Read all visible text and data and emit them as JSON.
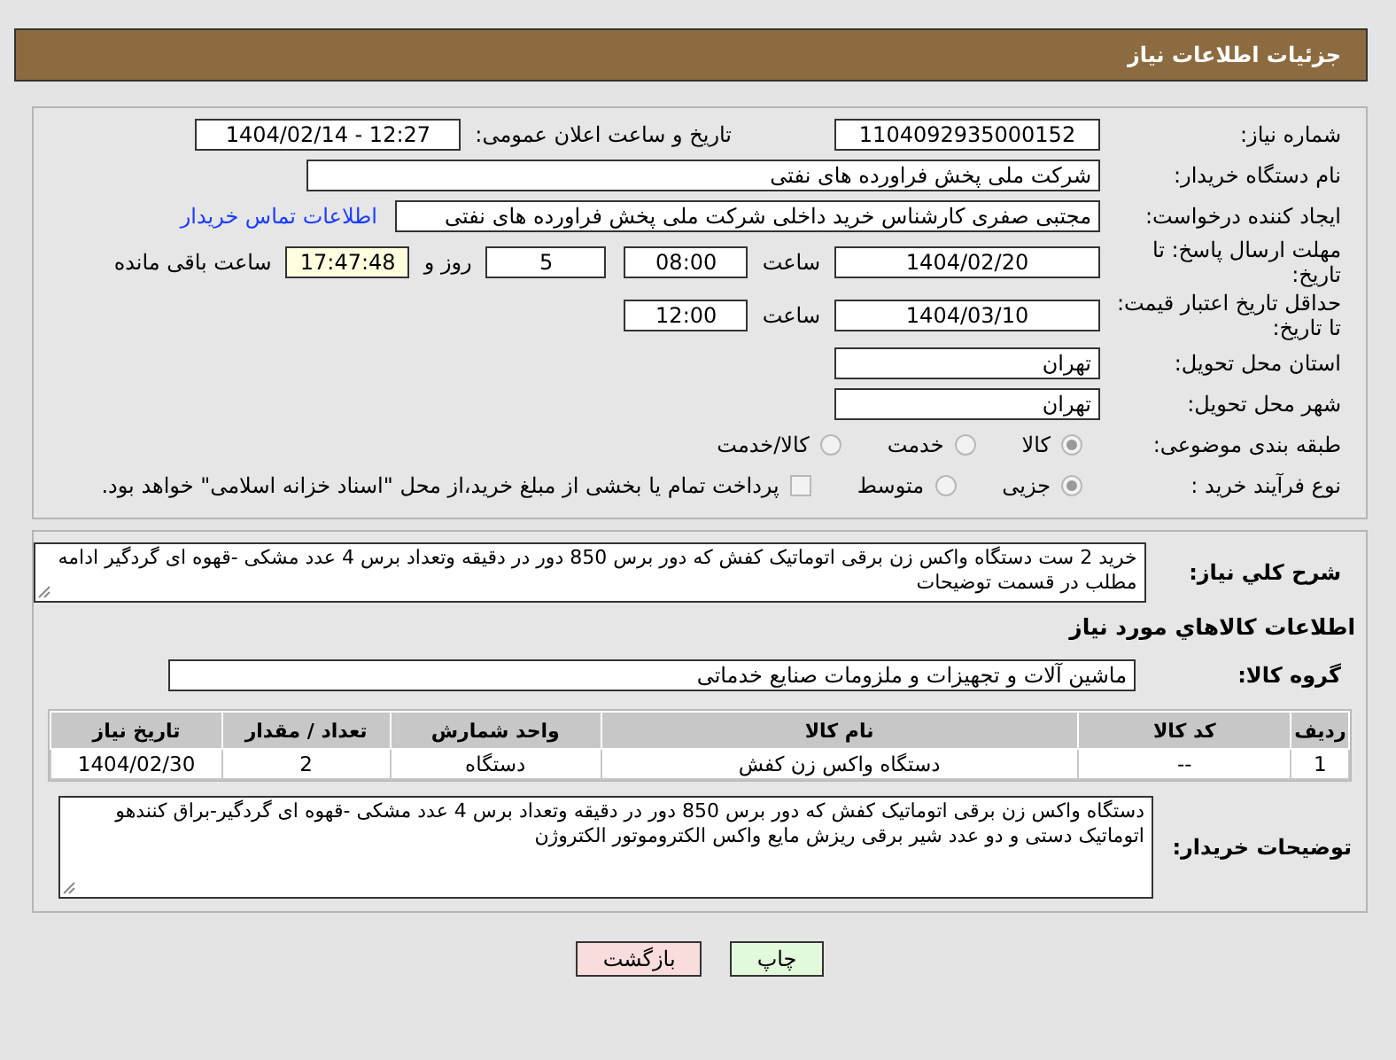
{
  "header": {
    "title": "جزئیات اطلاعات نیاز"
  },
  "need_number": {
    "label": "شماره نیاز:",
    "value": "1104092935000152"
  },
  "announce": {
    "label": "تاریخ و ساعت اعلان عمومی:",
    "value": "1404/02/14 - 12:27"
  },
  "buyer_org": {
    "label": "نام دستگاه خریدار:",
    "value": "شرکت ملی پخش فراورده های نفتی"
  },
  "requester": {
    "label": "ایجاد کننده درخواست:",
    "value": "مجتبی صفری کارشناس خرید داخلی شرکت ملی پخش فراورده های نفتی",
    "link": "اطلاعات تماس خریدار"
  },
  "deadline": {
    "label": "مهلت ارسال پاسخ: تا تاریخ:",
    "date": "1404/02/20",
    "time_label": "ساعت",
    "time": "08:00",
    "days": "5",
    "days_label": "روز و",
    "remaining": "17:47:48",
    "remaining_label": "ساعت باقی مانده"
  },
  "validity": {
    "label": "حداقل تاریخ اعتبار قیمت: تا تاریخ:",
    "date": "1404/03/10",
    "time_label": "ساعت",
    "time": "12:00"
  },
  "province": {
    "label": "استان محل تحویل:",
    "value": "تهران"
  },
  "city": {
    "label": "شهر محل تحویل:",
    "value": "تهران"
  },
  "category": {
    "label": "طبقه بندی موضوعی:",
    "options": [
      {
        "label": "کالا",
        "selected": true
      },
      {
        "label": "خدمت",
        "selected": false
      },
      {
        "label": "کالا/خدمت",
        "selected": false
      }
    ]
  },
  "process": {
    "label": "نوع فرآیند خرید :",
    "options": [
      {
        "label": "جزیی",
        "selected": true
      },
      {
        "label": "متوسط",
        "selected": false
      }
    ],
    "payment_note": {
      "label": "پرداخت تمام یا بخشی از مبلغ خرید،از محل \"اسناد خزانه اسلامی\" خواهد بود.",
      "checked": false
    }
  },
  "description": {
    "label": "شرح کلي نياز:",
    "value": "خرید 2 ست دستگاه واکس زن برقی اتوماتیک کفش که دور برس 850 دور در دقیقه وتعداد برس 4 عدد مشکی -قهوه ای گردگیر ادامه مطلب در قسمت توضیحات"
  },
  "goods_title": "اطلاعات کالاهاي مورد نياز",
  "goods_group": {
    "label": "گروه کالا:",
    "value": "ماشین آلات و تجهیزات و ملزومات صنایع خدماتی"
  },
  "table": {
    "columns": [
      "ردیف",
      "کد کالا",
      "نام کالا",
      "واحد شمارش",
      "تعداد / مقدار",
      "تاریخ نیاز"
    ],
    "rows": [
      [
        "1",
        "--",
        "دستگاه واکس زن کفش",
        "دستگاه",
        "2",
        "1404/02/30"
      ]
    ]
  },
  "buyer_notes": {
    "label": "توضیحات خریدار:",
    "value": "دستگاه واکس زن برقی اتوماتیک کفش که دور برس 850 دور در دقیقه وتعداد برس 4 عدد مشکی -قهوه ای گردگیر-براق کنندهو اتوماتیک دستی و دو عدد شیر برقی ریزش مایع واکس الکتروموتور الکتروژن"
  },
  "buttons": [
    {
      "label": "چاپ",
      "kind": "print"
    },
    {
      "label": "بازگشت",
      "kind": "back"
    }
  ]
}
